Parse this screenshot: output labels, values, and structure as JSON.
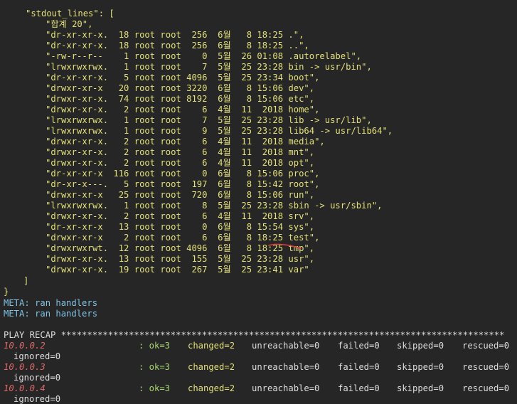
{
  "header_marker": "'",
  "stdout_key": "\"stdout_lines\": [",
  "lines": [
    "\"합계 20\",",
    "\"dr-xr-xr-x.  18 root root  256  6월   8 18:25 .\",",
    "\"dr-xr-xr-x.  18 root root  256  6월   8 18:25 ..\",",
    "\"-rw-r--r--    1 root root    0  5월  26 01:08 .autorelabel\",",
    "\"lrwxrwxrwx.   1 root root    7  5월  25 23:28 bin -> usr/bin\",",
    "\"dr-xr-xr-x.   5 root root 4096  5월  25 23:34 boot\",",
    "\"drwxr-xr-x   20 root root 3220  6월   8 15:06 dev\",",
    "\"drwxr-xr-x.  74 root root 8192  6월   8 15:06 etc\",",
    "\"drwxr-xr-x.   2 root root    6  4월  11  2018 home\",",
    "\"lrwxrwxrwx.   1 root root    7  5월  25 23:28 lib -> usr/lib\",",
    "\"lrwxrwxrwx.   1 root root    9  5월  25 23:28 lib64 -> usr/lib64\",",
    "\"drwxr-xr-x.   2 root root    6  4월  11  2018 media\",",
    "\"drwxr-xr-x.   2 root root    6  4월  11  2018 mnt\",",
    "\"drwxr-xr-x.   2 root root    6  4월  11  2018 opt\",",
    "\"dr-xr-xr-x  116 root root    0  6월   8 15:06 proc\",",
    "\"dr-xr-x---.   5 root root  197  6월   8 15:42 root\",",
    "\"drwxr-xr-x   25 root root  720  6월   8 15:06 run\",",
    "\"lrwxrwxrwx.   1 root root    8  5월  25 23:28 sbin -> usr/sbin\",",
    "\"drwxr-xr-x.   2 root root    6  4월  11  2018 srv\",",
    "\"dr-xr-xr-x   13 root root    0  6월   8 15:54 sys\",",
    "\"drwxr-xr-x    2 root root    6  6월   8 18:25 test\",",
    "\"drwxrwxrwt.  12 root root 4096  6월   8 18:25 tmp\",",
    "\"drwxr-xr-x.  13 root root  155  5월  25 23:28 usr\",",
    "\"drwxr-xr-x.  19 root root  267  5월  25 23:41 var\""
  ],
  "close_bracket": "]",
  "close_brace": "}",
  "meta_lines": [
    "META: ran handlers",
    "META: ran handlers"
  ],
  "play_recap": "PLAY RECAP *************************************************************************************",
  "recap": [
    {
      "host": "10.0.0.2",
      "ok": ": ok=3",
      "changed": "changed=2",
      "unreachable": "unreachable=0",
      "failed": "failed=0",
      "skipped": "skipped=0",
      "rescued": "rescued=0",
      "ignored": "ignored=0"
    },
    {
      "host": "10.0.0.3",
      "ok": ": ok=3",
      "changed": "changed=2",
      "unreachable": "unreachable=0",
      "failed": "failed=0",
      "skipped": "skipped=0",
      "rescued": "rescued=0",
      "ignored": "ignored=0"
    },
    {
      "host": "10.0.0.4",
      "ok": ": ok=3",
      "changed": "changed=2",
      "unreachable": "unreachable=0",
      "failed": "failed=0",
      "skipped": "skipped=0",
      "rescued": "rescued=0",
      "ignored": "ignored=0"
    }
  ],
  "colors": {
    "background": "#262626",
    "stdout": "#e3e07a",
    "meta": "#7fc3e6",
    "ok": "#a7d66f",
    "host": "#e06767",
    "annotation": "#d43c3c"
  }
}
